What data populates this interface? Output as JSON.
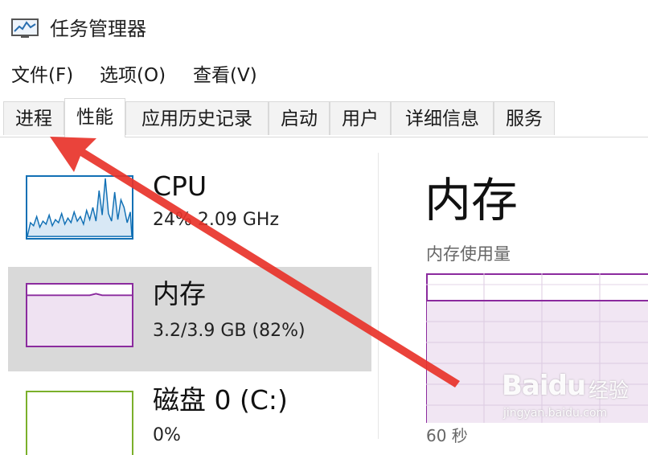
{
  "window": {
    "title": "任务管理器"
  },
  "menu": [
    {
      "label": "文件(F)"
    },
    {
      "label": "选项(O)"
    },
    {
      "label": "查看(V)"
    }
  ],
  "tabs": [
    {
      "label": "进程",
      "active": false
    },
    {
      "label": "性能",
      "active": true
    },
    {
      "label": "应用历史记录",
      "active": false
    },
    {
      "label": "启动",
      "active": false
    },
    {
      "label": "用户",
      "active": false
    },
    {
      "label": "详细信息",
      "active": false
    },
    {
      "label": "服务",
      "active": false
    }
  ],
  "sidebar": {
    "items": [
      {
        "title": "CPU",
        "subtitle": "24% 2.09 GHz",
        "selected": false
      },
      {
        "title": "内存",
        "subtitle": "3.2/3.9 GB (82%)",
        "selected": true
      },
      {
        "title": "磁盘 0 (C:)",
        "subtitle": "0%",
        "selected": false
      }
    ]
  },
  "main": {
    "title": "内存",
    "subtitle": "内存使用量",
    "time_label": "60 秒"
  },
  "colors": {
    "cpu": "#1170b5",
    "memory": "#8b2b9e",
    "disk": "#7bb02b",
    "arrow": "#e8332a",
    "selected_bg": "#d9d9d9"
  },
  "watermark": {
    "brand": "Baidu",
    "suffix": "经验",
    "url": "jingyan.baidu.com"
  }
}
